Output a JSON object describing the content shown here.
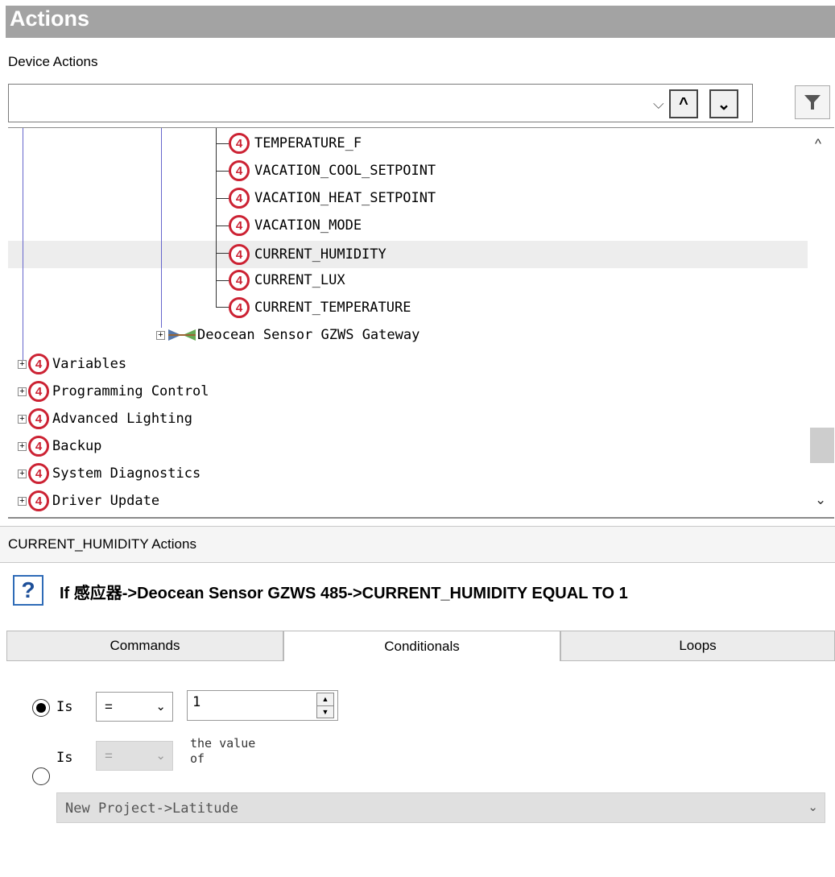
{
  "panel": {
    "title": "Actions"
  },
  "device_actions": {
    "label": "Device Actions",
    "search_value": "",
    "chev": "⌵",
    "up_glyph": "^",
    "down_glyph": "⌄"
  },
  "tree": {
    "children": [
      {
        "label": "TEMPERATURE_F"
      },
      {
        "label": "VACATION_COOL_SETPOINT"
      },
      {
        "label": "VACATION_HEAT_SETPOINT"
      },
      {
        "label": "VACATION_MODE"
      },
      {
        "label": "CURRENT_HUMIDITY"
      },
      {
        "label": "CURRENT_LUX"
      },
      {
        "label": "CURRENT_TEMPERATURE"
      }
    ],
    "gateway": "Deocean Sensor GZWS Gateway",
    "roots": [
      {
        "label": "Variables"
      },
      {
        "label": "Programming Control"
      },
      {
        "label": "Advanced Lighting"
      },
      {
        "label": "Backup"
      },
      {
        "label": "System Diagnostics"
      },
      {
        "label": "Driver Update"
      }
    ],
    "scroll_up": "^",
    "scroll_down": "⌄"
  },
  "selected_actions": {
    "header": "CURRENT_HUMIDITY Actions",
    "statement": "If 感应器->Deocean Sensor GZWS 485->CURRENT_HUMIDITY EQUAL TO 1",
    "help_glyph": "?"
  },
  "tabs": {
    "commands": "Commands",
    "conditionals": "Conditionals",
    "loops": "Loops"
  },
  "conditional": {
    "row1": {
      "label": "Is",
      "operator": "=",
      "value": "1",
      "selected": true
    },
    "row2": {
      "label": "Is",
      "operator": "=",
      "value_of_label": "the value\nof",
      "selected": false
    },
    "variable_select": "New Project->Latitude"
  }
}
